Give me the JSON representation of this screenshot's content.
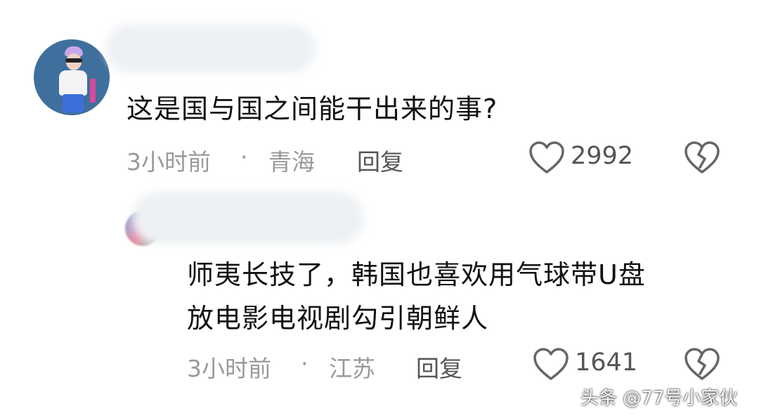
{
  "comments": [
    {
      "text": "这是国与国之间能干出来的事?",
      "time": "3小时前",
      "separator": "·",
      "location": "青海",
      "reply_label": "回复",
      "likes": "2992"
    },
    {
      "text_line1": "师夷长技了，韩国也喜欢用气球带U盘",
      "text_line2": "放电影电视剧勾引朝鲜人",
      "time": "3小时前",
      "separator": "·",
      "location": "江苏",
      "reply_label": "回复",
      "likes": "1641"
    }
  ],
  "watermark": "头条 @77号小家伙",
  "icons": {
    "like": "heart-outline-icon",
    "dislike": "broken-heart-icon"
  },
  "colors": {
    "text": "#111111",
    "meta": "#9a9a9a",
    "icon": "#666666"
  }
}
